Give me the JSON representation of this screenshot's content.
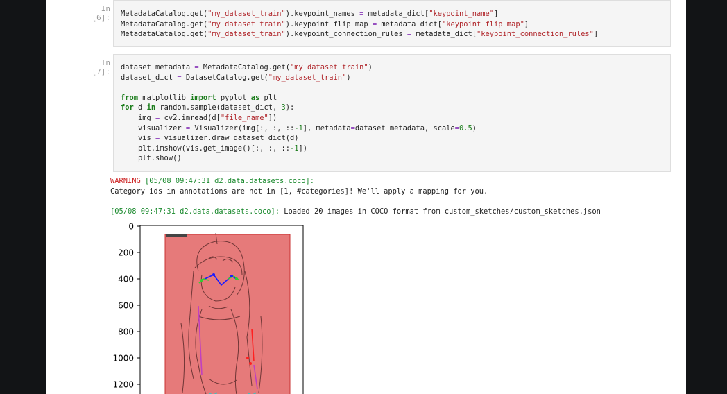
{
  "cell6": {
    "prompt": "In [6]:",
    "lines": [
      {
        "pre": "MetadataCatalog.get(",
        "str": "\"my_dataset_train\"",
        "mid": ").keypoint_names ",
        "op": "=",
        "post": " metadata_dict[",
        "str2": "\"keypoint_name\"",
        "end": "]"
      },
      {
        "pre": "MetadataCatalog.get(",
        "str": "\"my_dataset_train\"",
        "mid": ").keypoint_flip_map ",
        "op": "=",
        "post": " metadata_dict[",
        "str2": "\"keypoint_flip_map\"",
        "end": "]"
      },
      {
        "pre": "MetadataCatalog.get(",
        "str": "\"my_dataset_train\"",
        "mid": ").keypoint_connection_rules ",
        "op": "=",
        "post": " metadata_dict[",
        "str2": "\"keypoint_connection_rules\"",
        "end": "]"
      }
    ]
  },
  "cell7": {
    "prompt": "In [7]:",
    "l1a": "dataset_metadata ",
    "l1op": "=",
    "l1b": " MetadataCatalog.get(",
    "l1s": "\"my_dataset_train\"",
    "l1c": ")",
    "l2a": "dataset_dict ",
    "l2op": "=",
    "l2b": " DatasetCatalog.get(",
    "l2s": "\"my_dataset_train\"",
    "l2c": ")",
    "l3k1": "from",
    "l3a": " matplotlib ",
    "l3k2": "import",
    "l3b": " pyplot ",
    "l3k3": "as",
    "l3c": " plt",
    "l4k1": "for",
    "l4a": " d ",
    "l4k2": "in",
    "l4b": " random.sample(dataset_dict, ",
    "l4n": "3",
    "l4c": "):",
    "l5a": "    img ",
    "l5op": "=",
    "l5b": " cv2.imread(d[",
    "l5s": "\"file_name\"",
    "l5c": "])",
    "l6a": "    visualizer ",
    "l6op": "=",
    "l6b": " Visualizer(img[:, :, ::",
    "l6n": "-1",
    "l6c": "], metadata",
    "l6op2": "=",
    "l6d": "dataset_metadata, scale",
    "l6op3": "=",
    "l6n2": "0.5",
    "l6e": ")",
    "l7a": "    vis ",
    "l7op": "=",
    "l7b": " visualizer.draw_dataset_dict(d)",
    "l8a": "    plt.imshow(vis.get_image()[:, :, ::",
    "l8n": "-1",
    "l8b": "])",
    "l9a": "    plt.show()"
  },
  "output": {
    "warn_kw": "WARNING",
    "warn_src": " [05/08 09:47:31 d2.data.datasets.coco]:",
    "warn_msg": "Category ids in annotations are not in [1, #categories]! We'll apply a mapping for you.",
    "info_src": "[05/08 09:47:31 d2.data.datasets.coco]:",
    "info_msg": " Loaded 20 images in COCO format from custom_sketches/custom_sketches.json"
  },
  "plot": {
    "y_ticks": [
      "0",
      "200",
      "400",
      "600",
      "800",
      "1000",
      "1200"
    ],
    "box_color": "#e57373",
    "skeleton_colors": {
      "face": "#1a1aff",
      "eyes": "#33cc33",
      "limb_left": "#c040c0",
      "limb_right": "#ff2020"
    }
  }
}
